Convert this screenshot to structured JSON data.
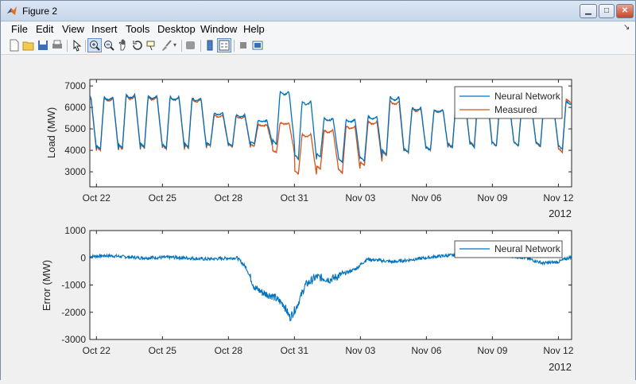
{
  "window": {
    "title": "Figure 2"
  },
  "menu": [
    "File",
    "Edit",
    "View",
    "Insert",
    "Tools",
    "Desktop",
    "Window",
    "Help"
  ],
  "toolbar_icons": [
    "new-figure-icon",
    "open-file-icon",
    "save-icon",
    "print-icon",
    "pointer-icon",
    "zoom-in-icon",
    "zoom-out-icon",
    "pan-icon",
    "rotate-3d-icon",
    "data-cursor-icon",
    "brush-icon",
    "link-plot-icon",
    "colorbar-icon",
    "legend-icon",
    "hide-plot-tools-icon",
    "show-plot-tools-icon"
  ],
  "colors": {
    "neural_network": "#0072bd",
    "measured": "#d95319"
  },
  "chart_data": [
    {
      "type": "line",
      "ylabel": "Load (MW)",
      "xlabel": "",
      "x_tick_labels": [
        "Oct 22",
        "Oct 25",
        "Oct 28",
        "Oct 31",
        "Nov 03",
        "Nov 06",
        "Nov 09",
        "Nov 12"
      ],
      "x_year_label": "2012",
      "x_range_days": [
        21.7,
        43.6
      ],
      "x_tick_days": [
        22,
        25,
        28,
        31,
        34,
        37,
        40,
        43
      ],
      "ylim": [
        2300,
        7300
      ],
      "y_ticks": [
        3000,
        4000,
        5000,
        6000,
        7000
      ],
      "legend": [
        "Neural Network",
        "Measured"
      ],
      "legend_position": "top-right",
      "grid": false,
      "day_peaks_nn": [
        6500,
        6600,
        6550,
        6500,
        6450,
        5750,
        5650,
        5400,
        6750,
        6300,
        5500,
        5450,
        5600,
        6500,
        6000,
        5900,
        6350,
        6650,
        6300,
        6250,
        6300,
        6300
      ],
      "day_mins_nn": [
        4050,
        4100,
        4150,
        4100,
        4150,
        4250,
        4200,
        4300,
        4300,
        3600,
        3700,
        3450,
        3500,
        3800,
        3900,
        4000,
        4100,
        4150,
        4200,
        4200,
        4200,
        4050
      ],
      "day_peaks_measured": [
        6450,
        6550,
        6500,
        6500,
        6400,
        5650,
        5600,
        5200,
        5300,
        4750,
        4950,
        5150,
        5350,
        6300,
        5950,
        5900,
        6350,
        6800,
        6400,
        6300,
        6350,
        6400
      ],
      "day_mins_measured": [
        4000,
        4050,
        4100,
        4050,
        4100,
        4200,
        4150,
        4200,
        3900,
        2900,
        3150,
        2950,
        3300,
        3750,
        3900,
        4000,
        4150,
        4200,
        4200,
        4200,
        4150,
        3900
      ]
    },
    {
      "type": "line",
      "ylabel": "Error (MW)",
      "xlabel": "",
      "x_tick_labels": [
        "Oct 22",
        "Oct 25",
        "Oct 28",
        "Oct 31",
        "Nov 03",
        "Nov 06",
        "Nov 09",
        "Nov 12"
      ],
      "x_year_label": "2012",
      "x_range_days": [
        21.7,
        43.6
      ],
      "x_tick_days": [
        22,
        25,
        28,
        31,
        34,
        37,
        40,
        43
      ],
      "ylim": [
        -3000,
        1000
      ],
      "y_ticks": [
        -3000,
        -2000,
        -1000,
        0,
        1000
      ],
      "legend": [
        "Neural Network"
      ],
      "legend_position": "top-right",
      "grid": false,
      "error_trend": [
        [
          21.7,
          50
        ],
        [
          22.5,
          80
        ],
        [
          24,
          0
        ],
        [
          25.5,
          20
        ],
        [
          27,
          -50
        ],
        [
          28.4,
          0
        ],
        [
          28.8,
          -350
        ],
        [
          29.2,
          -1100
        ],
        [
          29.6,
          -1300
        ],
        [
          30.0,
          -1400
        ],
        [
          30.5,
          -1700
        ],
        [
          30.8,
          -2200
        ],
        [
          31.1,
          -1800
        ],
        [
          31.5,
          -1000
        ],
        [
          32.0,
          -700
        ],
        [
          32.6,
          -800
        ],
        [
          33.2,
          -600
        ],
        [
          33.8,
          -400
        ],
        [
          34.3,
          -50
        ],
        [
          35.5,
          -150
        ],
        [
          36.5,
          -50
        ],
        [
          37.5,
          50
        ],
        [
          39.0,
          150
        ],
        [
          40.5,
          100
        ],
        [
          41.5,
          0
        ],
        [
          42.3,
          -200
        ],
        [
          43.0,
          -150
        ],
        [
          43.6,
          50
        ]
      ]
    }
  ]
}
